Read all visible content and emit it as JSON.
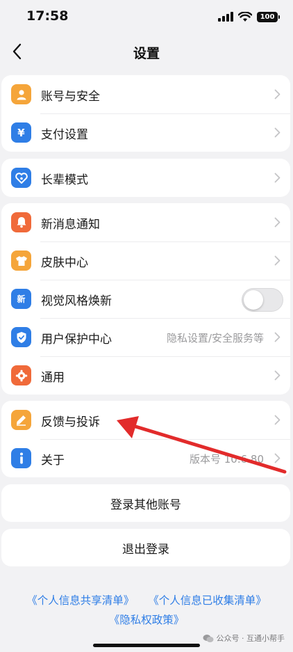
{
  "status_bar": {
    "time": "17:58",
    "battery": "100"
  },
  "nav": {
    "title": "设置"
  },
  "groups": [
    {
      "items": [
        {
          "label": "账号与安全",
          "icon": "user-icon"
        },
        {
          "label": "支付设置",
          "icon": "yen-icon"
        }
      ]
    },
    {
      "items": [
        {
          "label": "长辈模式",
          "icon": "heart-icon"
        }
      ]
    },
    {
      "items": [
        {
          "label": "新消息通知",
          "icon": "bell-icon"
        },
        {
          "label": "皮肤中心",
          "icon": "tshirt-icon"
        },
        {
          "label": "视觉风格焕新",
          "icon": "new-style-icon",
          "icon_text": "新"
        },
        {
          "label": "用户保护中心",
          "icon": "shield-icon",
          "value": "隐私设置/安全服务等"
        },
        {
          "label": "通用",
          "icon": "gear-icon"
        }
      ]
    },
    {
      "items": [
        {
          "label": "反馈与投诉",
          "icon": "pencil-icon"
        },
        {
          "label": "关于",
          "icon": "info-icon",
          "value": "版本号 10.6.80"
        }
      ]
    }
  ],
  "actions": {
    "switch_account": "登录其他账号",
    "logout": "退出登录"
  },
  "footer": {
    "link1": "《个人信息共享清单》",
    "link2": "《个人信息已收集清单》",
    "link3": "《隐私权政策》"
  },
  "watermark": "公众号 · 互通小帮手",
  "colors": {
    "orange": "#f5a53a",
    "blue": "#2f7ee6",
    "red_orange": "#f06a3a",
    "arrow": "#e22b2b"
  }
}
